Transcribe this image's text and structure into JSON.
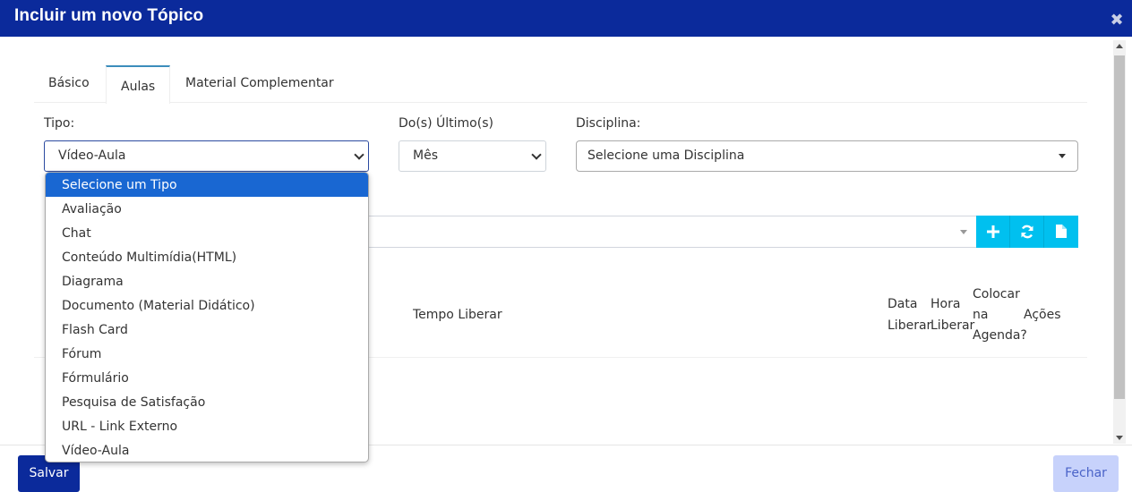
{
  "header": {
    "title": "Incluir um novo Tópico",
    "close_glyph": "✖"
  },
  "tabs": [
    {
      "label": "Básico",
      "active": false
    },
    {
      "label": "Aulas",
      "active": true
    },
    {
      "label": "Material Complementar",
      "active": false
    }
  ],
  "form": {
    "tipo": {
      "label": "Tipo:",
      "value": "Vídeo-Aula"
    },
    "ultimos": {
      "label": "Do(s) Último(s)",
      "value": "Mês"
    },
    "disciplina": {
      "label": "Disciplina:",
      "value": "Selecione uma Disciplina"
    }
  },
  "toolbar": {
    "add_icon": "plus-icon",
    "refresh_icon": "refresh-icon",
    "file_icon": "file-icon"
  },
  "table": {
    "headers": {
      "tempo_liberar": "Tempo Liberar",
      "data_liberar_1": "Data",
      "data_liberar_2": "Liberar",
      "hora_liberar_1": "Hora",
      "hora_liberar_2": "Liberar",
      "agenda_1": "Colocar",
      "agenda_2": "na",
      "agenda_3": "Agenda?",
      "acoes": "Ações"
    }
  },
  "dropdown": {
    "options": [
      "Selecione um Tipo",
      "Avaliação",
      "Chat",
      "Conteúdo Multimídia(HTML)",
      "Diagrama",
      "Documento (Material Didático)",
      "Flash Card",
      "Fórum",
      "Fórmulário",
      "Pesquisa de Satisfação",
      "URL - Link Externo",
      "Vídeo-Aula"
    ],
    "highlighted": "Selecione um Tipo"
  },
  "footer": {
    "save_label": "Salvar",
    "close_label": "Fechar"
  },
  "colors": {
    "header": "#0b2a9b",
    "accent_cyan": "#00c0ef",
    "highlight": "#1967d2",
    "close_button": "#c7d2fb"
  }
}
